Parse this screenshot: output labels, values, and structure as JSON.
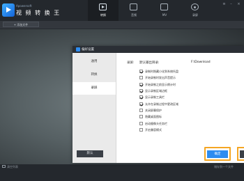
{
  "app": {
    "subtitle": "Apowersoft",
    "title": "视 频 转 换 王"
  },
  "nav": {
    "tabs": [
      {
        "label": "转换",
        "icon": "video-icon"
      },
      {
        "label": "音频",
        "icon": "audio-icon"
      },
      {
        "label": "MV",
        "icon": "mv-icon"
      },
      {
        "label": "录屏",
        "icon": "record-icon"
      }
    ],
    "active": "转换"
  },
  "toolbar": {
    "add_label": "+ 添加文件"
  },
  "dialog": {
    "title": "偏好设置",
    "sidebar": [
      "通用",
      "转换",
      "录屏"
    ],
    "active_sidebar": "录屏",
    "section_label": "录屏:",
    "path_label": "默认输出目录:",
    "path_value": "F:\\Download",
    "options": [
      {
        "label": "录制时隐藏小化到系统托盘",
        "checked": true
      },
      {
        "label": "开始录制时发出声音提示",
        "checked": false
      },
      {
        "label": "开始录制之前显示倒计时",
        "checked": true
      },
      {
        "label": "显示录制区域边框",
        "checked": true
      },
      {
        "label": "显示录制工具栏",
        "checked": true
      },
      {
        "label": "允许在录制过程中更改区域",
        "checked": true
      },
      {
        "label": "关闭屏幕保护",
        "checked": false
      },
      {
        "label": "隐藏桌面图标",
        "checked": false
      },
      {
        "label": "启动摄像头任务栏",
        "checked": false
      },
      {
        "label": "开启兼容模式",
        "checked": false
      }
    ],
    "default_button": "默认",
    "ok_button": "确定"
  },
  "bottom": {
    "left_label": "清空列表",
    "right_label": "储存到一个文件"
  },
  "colors": {
    "accent": "#2d8cf0",
    "highlight": "#f5a623"
  }
}
